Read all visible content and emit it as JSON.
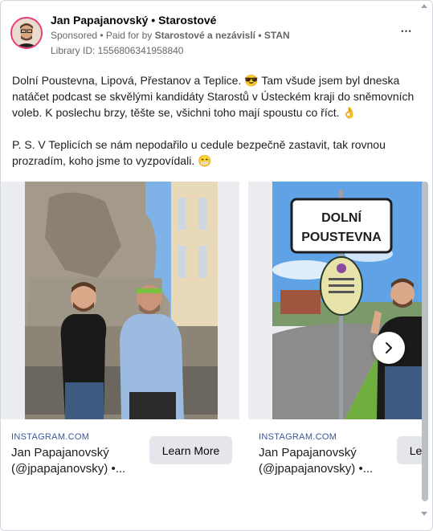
{
  "ad": {
    "page_name": "Jan Papajanovský • Starostové",
    "sponsored": "Sponsored",
    "paid_for_prefix": " • Paid for by ",
    "paid_by": "Starostové a nezávislí • STAN",
    "library_id": "Library ID: 1556806341958840",
    "more_icon": "⋯"
  },
  "body": {
    "paragraph1": "Dolní Poustevna, Lipová, Přestanov a Teplice. 😎 Tam všude jsem byl dneska natáčet podcast se skvělými kandidáty Starostů v Ústeckém kraji do sněmovních voleb. K poslechu brzy, těšte se, všichni toho mají spoustu co říct. 👌",
    "paragraph2": "P. S. V Teplicích se nám nepodařilo u cedule bezpečně zastavit, tak rovnou prozradím, koho jsme to vyzpovídali. 😁"
  },
  "cards": [
    {
      "source": "INSTAGRAM.COM",
      "title": "Jan Papajanovský (@jpapajanovsky) •...",
      "cta": "Learn More"
    },
    {
      "source": "INSTAGRAM.COM",
      "title": "Jan Papajanovský (@jpapajanovsky) •...",
      "cta": "Learn More",
      "sign_line1": "DOLNÍ",
      "sign_line2": "POUSTEVNA"
    }
  ],
  "colors": {
    "link_blue": "#385898",
    "button_gray": "#e4e6eb",
    "meta_gray": "#65676b"
  }
}
